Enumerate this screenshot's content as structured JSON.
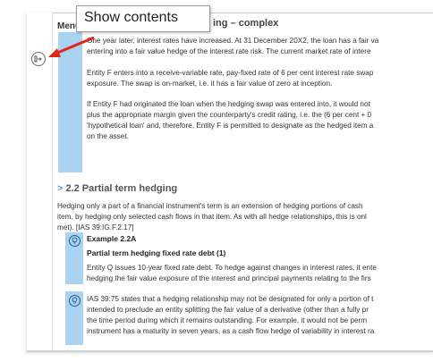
{
  "menu": {
    "label": "Menu"
  },
  "tooltip": {
    "text": "Show contents"
  },
  "section": {
    "title": "ing – complex"
  },
  "para1": [
    "One year later, interest rates have increased. At 31 December 20X2, the loan has a fair va",
    "entering into a fair value hedge of the interest rate risk. The current market rate of intere"
  ],
  "para2": [
    "Entity F enters into a receive-variable rate, pay-fixed rate of 6 per cent interest rate swap",
    "exposure. The swap is on-market, i.e. it has a fair value of zero at inception."
  ],
  "para3": [
    "If Entity F had originated the loan when the hedging swap was entered into, it would not",
    "plus the appropriate margin given the counterparty's credit rating, i.e. the (6 per cent + 0",
    "'hypothetical loan' and, therefore, Entity F is permitted to designate as the hedged item a",
    "on the asset."
  ],
  "heading22": {
    "chevron": ">",
    "title": "2.2 Partial term hedging"
  },
  "para4": [
    "Hedging only a part of a financial instrument's term is an extension of hedging portions of cash",
    "item, by hedging only selected cash flows in that item. As with all hedge relationships, this is onl",
    "met). [IAS 39:IG.F.2.17]"
  ],
  "example": {
    "label": "Example 2.2A",
    "title": "Partial term hedging fixed rate debt (1)",
    "lines": [
      "Entity Q issues 10-year fixed rate debt. To hedge against changes in interest rates, it ente",
      "hedging the fair value exposure of the interest and principal payments relating to the firs"
    ]
  },
  "ias": {
    "lines": [
      "IAS 39:75 states that a hedging relationship may not be designated for only a portion of t",
      "intended to preclude an entity splitting the fair value of a derivative (other than a fully pr",
      "the time period during which it remains outstanding. For example, it would not be perm",
      "instrument has a maturity in seven years, as a cash flow hedge of variability in interest ra"
    ]
  },
  "colors": {
    "accent": "#aad3f2",
    "arrow": "#e0251b",
    "link": "#2a86d1"
  },
  "icons": {
    "expand": "expand-contents-icon",
    "bulb": "lightbulb-icon",
    "arrow": "red-arrow-icon"
  }
}
